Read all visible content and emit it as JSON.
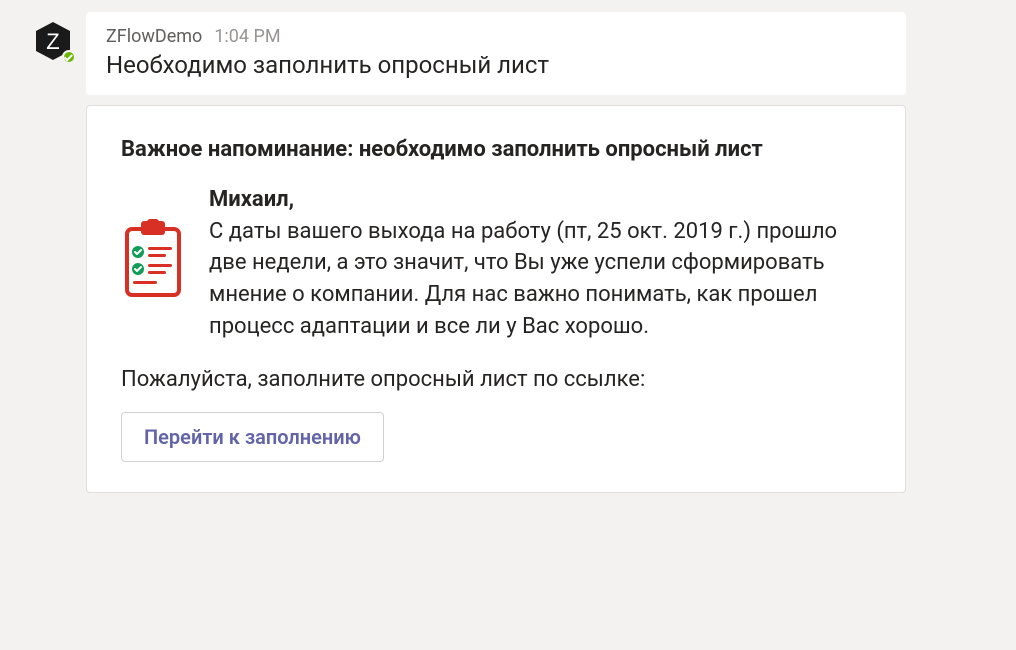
{
  "message": {
    "sender": "ZFlowDemo",
    "timestamp": "1:04 PM",
    "subject": "Необходимо заполнить опросный лист"
  },
  "card": {
    "title": "Важное напоминание: необходимо заполнить опросный лист",
    "greeting": "Михаил,",
    "body": "С даты вашего выхода на работу (пт, 25 окт. 2019 г.) прошло две недели, а это значит, что Вы уже успели сформировать мнение о компании. Для нас важно понимать, как прошел процесс адаптации и все ли у Вас хорошо.",
    "footer": "Пожалуйста, заполните опросный лист по ссылке:",
    "button_label": "Перейти к заполнению"
  },
  "avatar": {
    "letter": "Z"
  }
}
